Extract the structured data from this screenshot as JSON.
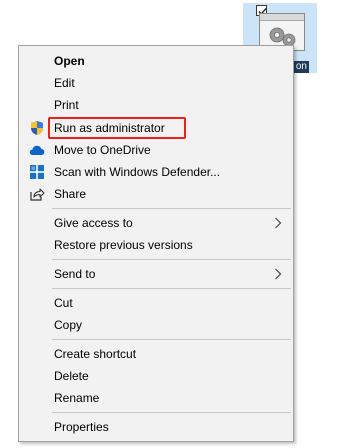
{
  "desktop_icon": {
    "caption": "on"
  },
  "menu": {
    "items": [
      {
        "label": "Open",
        "icon": ""
      },
      {
        "label": "Edit",
        "icon": ""
      },
      {
        "label": "Print",
        "icon": ""
      },
      {
        "label": "Run as administrator",
        "icon": "uac-shield-icon"
      },
      {
        "label": "Move to OneDrive",
        "icon": "onedrive-cloud-icon"
      },
      {
        "label": "Scan with Windows Defender...",
        "icon": "windows-defender-icon"
      },
      {
        "label": "Share",
        "icon": "share-icon"
      },
      {
        "label": "Give access to",
        "icon": "",
        "submenu": true
      },
      {
        "label": "Restore previous versions",
        "icon": ""
      },
      {
        "label": "Send to",
        "icon": "",
        "submenu": true
      },
      {
        "label": "Cut",
        "icon": ""
      },
      {
        "label": "Copy",
        "icon": ""
      },
      {
        "label": "Create shortcut",
        "icon": ""
      },
      {
        "label": "Delete",
        "icon": ""
      },
      {
        "label": "Rename",
        "icon": ""
      },
      {
        "label": "Properties",
        "icon": ""
      }
    ],
    "highlighted_item": "Run as administrator"
  },
  "colors": {
    "menu_background": "#f2f2f2",
    "highlight_border": "#e8211f",
    "icon_selection": "#cce4f7",
    "onedrive_blue": "#0a64c8",
    "defender_blue": "#1a73c8"
  }
}
